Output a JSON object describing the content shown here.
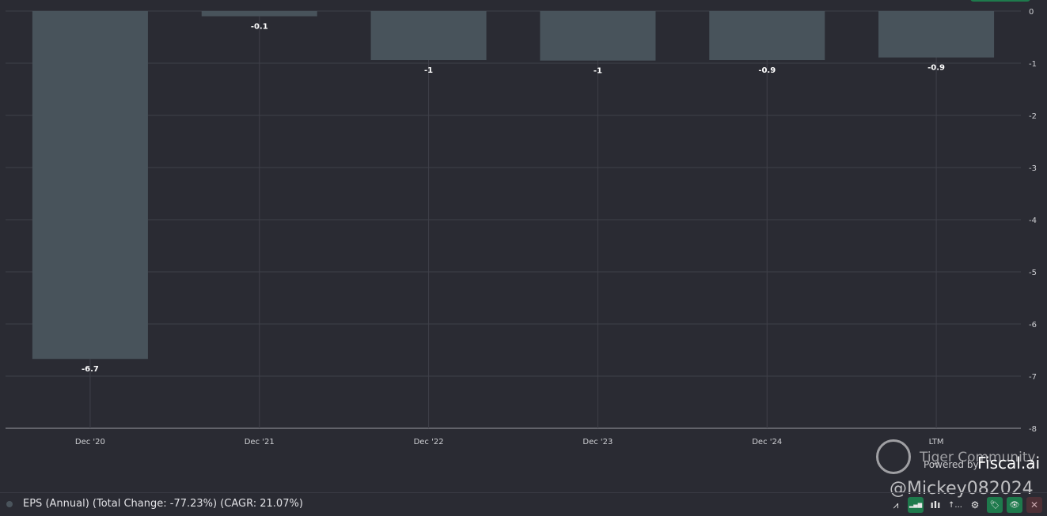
{
  "chart_data": {
    "type": "bar",
    "categories": [
      "Dec '20",
      "Dec '21",
      "Dec '22",
      "Dec '23",
      "Dec '24",
      "LTM"
    ],
    "values": [
      -6.67,
      -0.1,
      -0.94,
      -0.95,
      -0.94,
      -0.89
    ],
    "data_labels": [
      "-6.7",
      "-0.1",
      "-1",
      "-1",
      "-0.9",
      "-0.9"
    ],
    "ylim": [
      -8,
      0
    ],
    "yticks": [
      0,
      -1,
      -2,
      -3,
      -4,
      -5,
      -6,
      -7,
      -8
    ],
    "grid": true,
    "bar_color": "#48535b",
    "series_name": "EPS (Annual)"
  },
  "legend": {
    "text": "EPS (Annual) (Total Change: -77.23%) (CAGR: 21.07%)"
  },
  "watermark": {
    "community": "Tiger Community",
    "powered_by": "Powered by",
    "brand": "Fiscal.ai",
    "handle": "@Mickey082024"
  },
  "toolbar": {
    "items": [
      {
        "icon": "line-chart-icon",
        "label": "⩘"
      },
      {
        "icon": "bar-chart-icon",
        "label": "▂▄▆"
      },
      {
        "icon": "grouped-bar-icon",
        "label": "ıIı"
      },
      {
        "icon": "sort-icon",
        "label": "↑..."
      },
      {
        "icon": "gear-icon",
        "label": "⚙"
      },
      {
        "icon": "tag-icon",
        "label": "🏷"
      },
      {
        "icon": "eye-icon",
        "label": "👁"
      },
      {
        "icon": "close-icon",
        "label": "✕"
      }
    ]
  }
}
